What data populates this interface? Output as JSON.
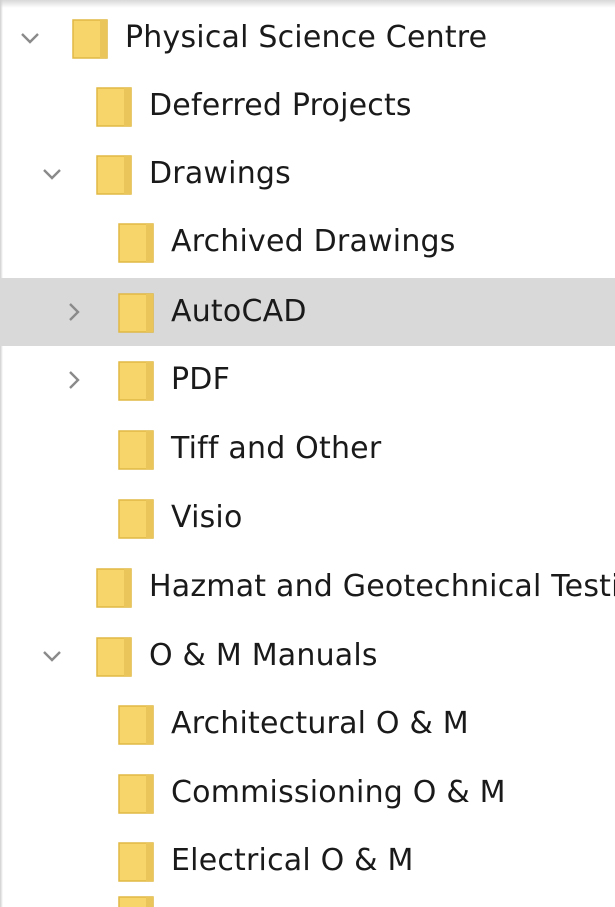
{
  "tree": {
    "items": [
      {
        "label": "Physical Science Centre",
        "level": 0,
        "expander": "expanded"
      },
      {
        "label": "Deferred Projects",
        "level": 1,
        "expander": "none"
      },
      {
        "label": "Drawings",
        "level": 1,
        "expander": "expanded"
      },
      {
        "label": "Archived Drawings",
        "level": 2,
        "expander": "none"
      },
      {
        "label": "AutoCAD",
        "level": 2,
        "expander": "collapsed",
        "selected": true
      },
      {
        "label": "PDF",
        "level": 2,
        "expander": "collapsed"
      },
      {
        "label": "Tiff and Other",
        "level": 2,
        "expander": "none"
      },
      {
        "label": "Visio",
        "level": 2,
        "expander": "none"
      },
      {
        "label": "Hazmat and Geotechnical Testi",
        "level": 1,
        "expander": "none"
      },
      {
        "label": "O & M Manuals",
        "level": 1,
        "expander": "expanded"
      },
      {
        "label": "Architectural O & M",
        "level": 2,
        "expander": "none"
      },
      {
        "label": "Commissioning O & M",
        "level": 2,
        "expander": "none"
      },
      {
        "label": "Electrical O & M",
        "level": 2,
        "expander": "none"
      }
    ]
  },
  "colors": {
    "folder_body": "#f7d56b",
    "folder_edge": "#e0b845",
    "selection": "#d9d9d9",
    "text": "#1a1a1a",
    "chevron": "#8a8a8a"
  },
  "icons": {
    "folder": "folder-icon",
    "expanded": "chevron-down-icon",
    "collapsed": "chevron-right-icon"
  }
}
